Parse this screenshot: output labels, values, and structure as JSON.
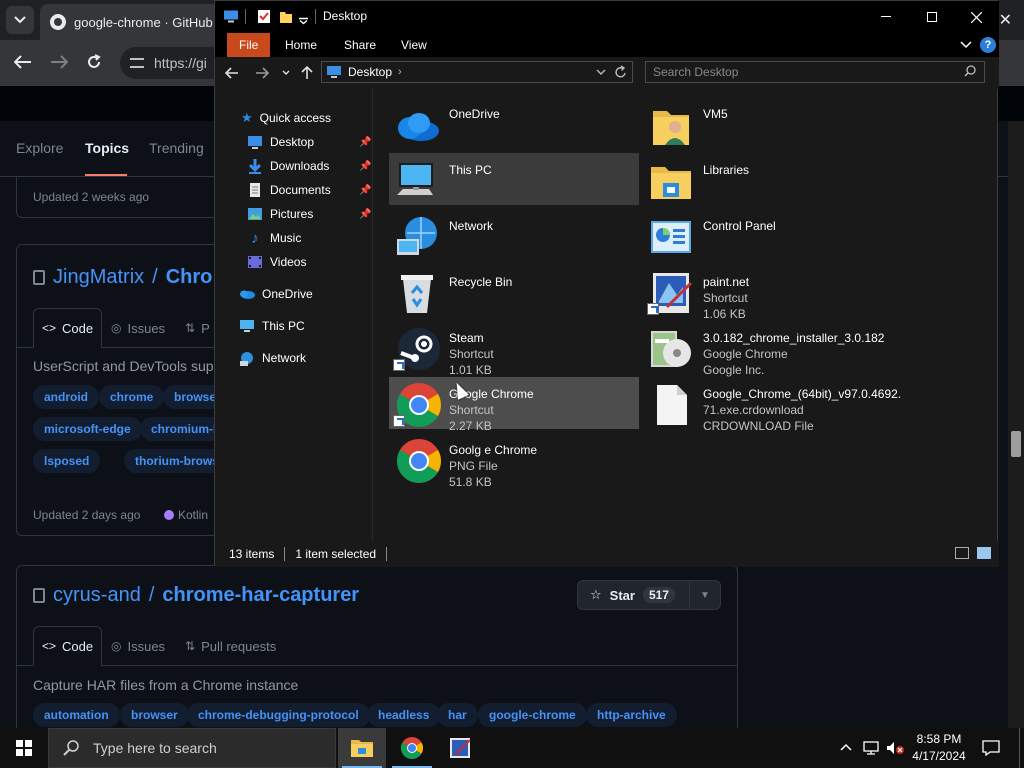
{
  "browser": {
    "tab_title": "google-chrome · GitHub T",
    "url_partial": "https://gi",
    "close_glyph": "✕"
  },
  "github": {
    "subnav": [
      {
        "label": "Explore",
        "active": false
      },
      {
        "label": "Topics",
        "active": true
      },
      {
        "label": "Trending",
        "active": false
      }
    ],
    "card0_updated": "Updated 2 weeks ago",
    "card1": {
      "owner": "JingMatrix",
      "name": "Chro",
      "tabs": [
        "Code",
        "Issues",
        "P"
      ],
      "description": "UserScript and DevTools supp",
      "topics": [
        "android",
        "chrome",
        "browse",
        "microsoft-edge",
        "chromium-l",
        "lsposed",
        "thorium-browser"
      ],
      "updated": "Updated 2 days ago",
      "language": "Kotlin",
      "language_color": "#a97bff"
    },
    "card2": {
      "owner": "cyrus-and",
      "name": "chrome-har-capturer",
      "star_label": "Star",
      "star_count": "517",
      "tabs": [
        "Code",
        "Issues",
        "Pull requests"
      ],
      "description": "Capture HAR files from a Chrome instance",
      "topics": [
        "automation",
        "browser",
        "chrome-debugging-protocol",
        "headless",
        "har",
        "google-chrome",
        "http-archive"
      ]
    }
  },
  "explorer": {
    "title": "Desktop",
    "ribbon_tabs": [
      "File",
      "Home",
      "Share",
      "View"
    ],
    "address": "Desktop",
    "search_placeholder": "Search Desktop",
    "nav": {
      "quick_access": "Quick access",
      "pinned": [
        "Desktop",
        "Downloads",
        "Documents",
        "Pictures"
      ],
      "unpinned": [
        "Music",
        "Videos"
      ],
      "onedrive": "OneDrive",
      "this_pc": "This PC",
      "network": "Network"
    },
    "items": [
      {
        "name": "OneDrive",
        "sub1": "",
        "sub2": "",
        "icon": "onedrive-icon"
      },
      {
        "name": "VM5",
        "sub1": "",
        "sub2": "",
        "icon": "user-folder-icon"
      },
      {
        "name": "This PC",
        "sub1": "",
        "sub2": "",
        "icon": "computer-icon",
        "state": "hover"
      },
      {
        "name": "Libraries",
        "sub1": "",
        "sub2": "",
        "icon": "libraries-icon"
      },
      {
        "name": "Network",
        "sub1": "",
        "sub2": "",
        "icon": "network-icon"
      },
      {
        "name": "Control Panel",
        "sub1": "",
        "sub2": "",
        "icon": "control-panel-icon"
      },
      {
        "name": "Recycle Bin",
        "sub1": "",
        "sub2": "",
        "icon": "recycle-bin-icon"
      },
      {
        "name": "paint.net",
        "sub1": "Shortcut",
        "sub2": "1.06 KB",
        "icon": "paintnet-icon"
      },
      {
        "name": "Steam",
        "sub1": "Shortcut",
        "sub2": "1.01 KB",
        "icon": "steam-icon"
      },
      {
        "name": "3.0.182_chrome_installer_3.0.182",
        "sub1": "Google Chrome",
        "sub2": "Google Inc.",
        "icon": "installer-icon"
      },
      {
        "name": "Google Chrome",
        "sub1": "Shortcut",
        "sub2": "2.27 KB",
        "icon": "chrome-icon",
        "state": "selected"
      },
      {
        "name": "Google_Chrome_(64bit)_v97.0.4692.",
        "sub1": "71.exe.crdownload",
        "sub2": "CRDOWNLOAD File",
        "icon": "file-icon"
      },
      {
        "name": "Goolg e Chrome",
        "sub1": "PNG File",
        "sub2": "51.8 KB",
        "icon": "chrome-icon"
      }
    ],
    "status_count": "13 items",
    "status_selected": "1 item selected"
  },
  "taskbar": {
    "search_placeholder": "Type here to search",
    "time": "8:58 PM",
    "date": "4/17/2024"
  }
}
